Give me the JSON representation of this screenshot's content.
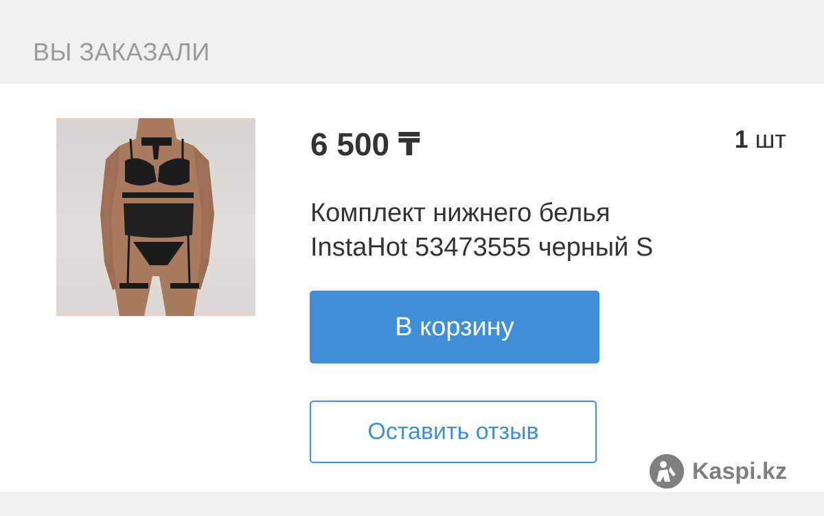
{
  "section": {
    "heading": "ВЫ ЗАКАЗАЛИ"
  },
  "order_item": {
    "price": "6 500 ₸",
    "quantity_number": "1",
    "quantity_unit": "шт",
    "title_line1": "Комплект нижнего белья",
    "title_line2": "InstaHot 53473555 черный S",
    "image_subject": "lingerie-set-photo"
  },
  "actions": {
    "add_to_cart_label": "В корзину",
    "leave_review_label": "Оставить отзыв"
  },
  "watermark": {
    "text": "Kaspi.kz",
    "icon": "kaspi-logo-icon"
  },
  "colors": {
    "accent": "#3e8fd7",
    "text_primary": "#333333",
    "text_muted": "#9a9a9a",
    "band_background": "#f0f0f0",
    "watermark": "#7f7f7f"
  }
}
